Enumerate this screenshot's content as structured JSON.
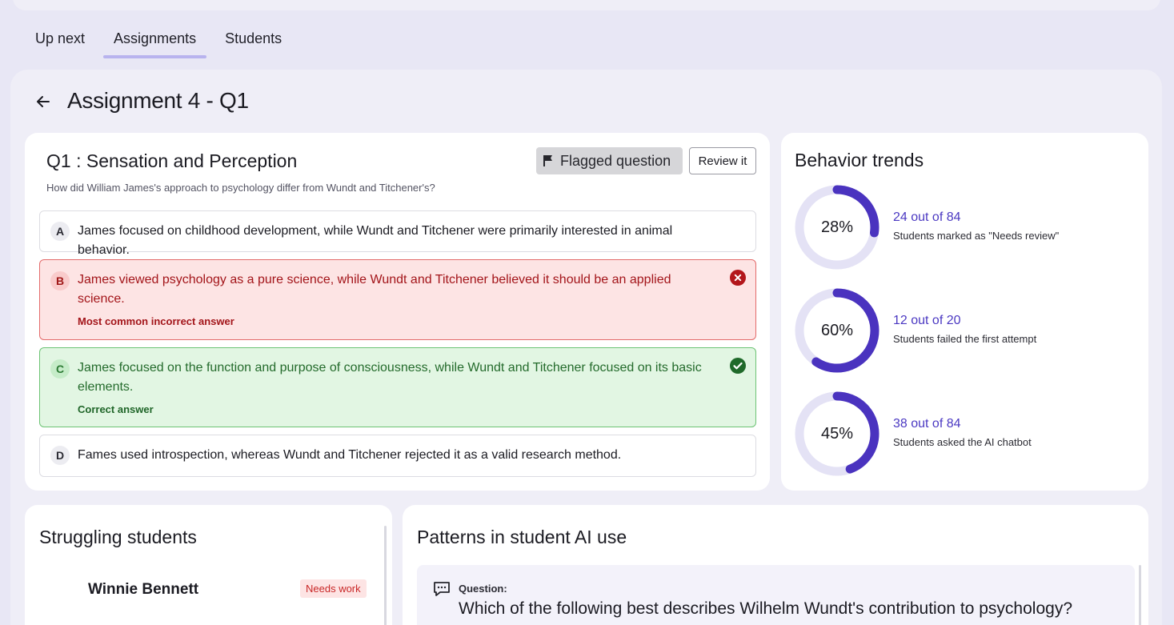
{
  "tabs": [
    "Up next",
    "Assignments",
    "Students"
  ],
  "page_title": "Assignment 4 - Q1",
  "question": {
    "title": "Q1 : Sensation and Perception",
    "prompt": "How did William James's approach to psychology differ from Wundt and Titchener's?",
    "flag_label": "Flagged question",
    "review_label": "Review it",
    "options": [
      {
        "letter": "A",
        "text": "James focused on childhood development, while Wundt and Titchener were primarily interested in animal behavior."
      },
      {
        "letter": "B",
        "text": "James viewed psychology as a pure science, while Wundt and Titchener believed it should be an applied science.",
        "note": "Most common incorrect answer"
      },
      {
        "letter": "C",
        "text": "James focused on the function and purpose of consciousness, while Wundt and Titchener focused on its basic elements.",
        "note": "Correct answer"
      },
      {
        "letter": "D",
        "text": "Fames used introspection, whereas Wundt and Titchener rejected it as a valid research method."
      }
    ]
  },
  "behavior": {
    "title": "Behavior trends",
    "colors": {
      "track": "#e4e2f5",
      "fill": "#4a33bf"
    },
    "trends": [
      {
        "pct_label": "28%",
        "fraction": 0.28,
        "count": "24 out of 84",
        "desc": "Students marked as \"Needs review\""
      },
      {
        "pct_label": "60%",
        "fraction": 0.6,
        "count": "12 out of 20",
        "desc": "Students failed the first attempt"
      },
      {
        "pct_label": "45%",
        "fraction": 0.45,
        "count": "38 out of 84",
        "desc": "Students asked the AI chatbot"
      }
    ]
  },
  "struggling": {
    "title": "Struggling students",
    "students": [
      {
        "name": "Winnie Bennett",
        "badge": "Needs work"
      }
    ]
  },
  "patterns": {
    "title": "Patterns in student AI use",
    "label": "Question:",
    "question": "Which of the following best describes Wilhelm Wundt's contribution to psychology?"
  }
}
